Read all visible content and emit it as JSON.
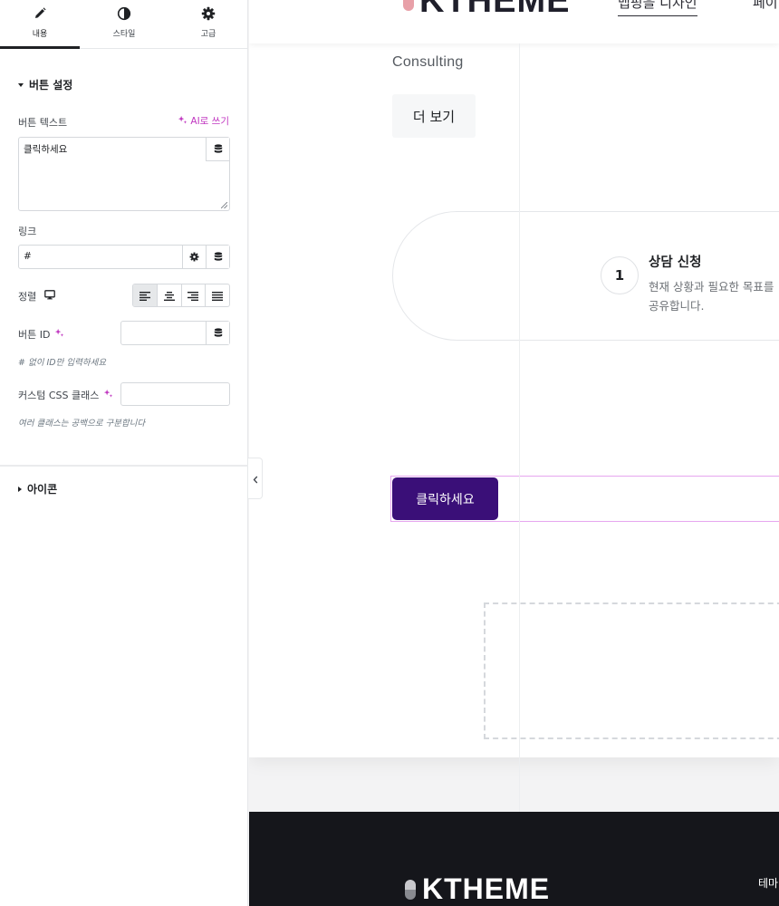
{
  "panel": {
    "tabs": [
      {
        "label": "내용",
        "icon": "pencil-icon"
      },
      {
        "label": "스타일",
        "icon": "contrast-icon"
      },
      {
        "label": "고급",
        "icon": "gear-icon"
      }
    ],
    "button_section": {
      "title": "버튼 설정",
      "text_label": "버튼 텍스트",
      "ai_label": "AI로 쓰기",
      "text_value": "클릭하세요",
      "link_label": "링크",
      "link_value": "#",
      "align_label": "정렬",
      "id_label": "버튼 ID",
      "id_note": "# 없이 ID만 입력하세요",
      "css_label": "커스텀 CSS 클래스",
      "css_note": "여러 클래스는 공백으로 구분합니다"
    },
    "icon_section": {
      "title": "아이콘"
    },
    "accent_color": "#c036c0"
  },
  "canvas": {
    "header": {
      "logo": "KTHEME",
      "nav_active": "맵핑을 디자인",
      "nav_next": "페이"
    },
    "consulting": "Consulting",
    "more_button": "더 보기",
    "step": {
      "number": "1",
      "title": "상담 신청",
      "desc_line1": "현재 상황과 필요한 목표를",
      "desc_line2": "공유합니다."
    },
    "cta_button": "클릭하세요",
    "cta_color": "#3a0f78",
    "footer": {
      "logo": "KTHEME",
      "nav": "테마"
    }
  }
}
